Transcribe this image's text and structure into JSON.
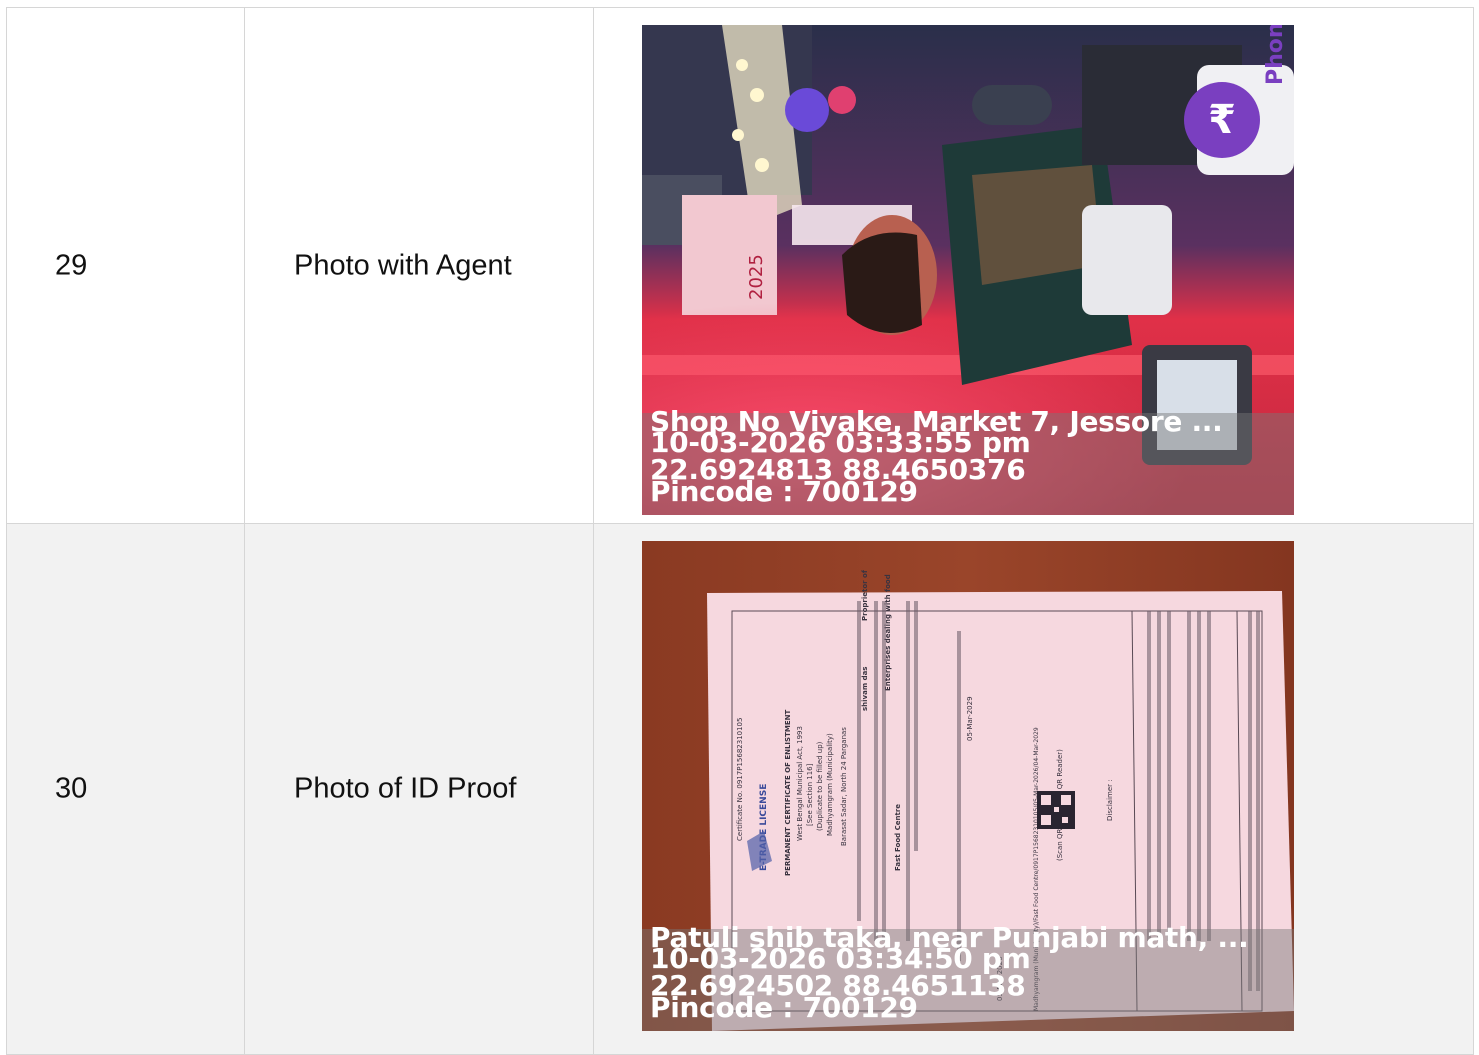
{
  "rows": [
    {
      "number": "29",
      "label": "Photo with Agent",
      "photo_caption": {
        "address": "Shop No Viyake, Market 7, Jessore ...",
        "datetime": "10-03-2026 03:33:55 pm",
        "coordinates": "22.6924813 88.4650376",
        "pincode": "Pincode : 700129"
      },
      "photo_text": {
        "brand": "PhonePe",
        "calendar": "2025"
      }
    },
    {
      "number": "30",
      "label": "Photo of ID Proof",
      "photo_caption": {
        "address": "Patuli shib taka, near Punjabi math, ...",
        "datetime": "10-03-2026 03:34:50 pm",
        "coordinates": "22.6924502 88.4651138",
        "pincode": "Pincode : 700129"
      },
      "document_text": {
        "certificate_no": "Certificate No. 0917P15682310105",
        "logo": "E-TRADE LICENSE",
        "heading": "PERMANENT CERTIFICATE OF ENLISTMENT",
        "act": "West Bengal Municipal Act, 1993",
        "section": "[See Section 116]",
        "duplicate": "(Duplicate to be filled up)",
        "municipality": "Madhyamgram (Municipality)",
        "district": "Barasat Sadar, North 24 Parganas",
        "holder": "shivam das",
        "role": "Proprietor of",
        "business": "Fast Food Centre",
        "nature": "Enterprises dealing with food",
        "validity": "05-Mar-2029",
        "issued": "05-Mar-2026",
        "qr_note": "(Scan QR Code with QR Reader)",
        "disclaimer": "Disclaimer :",
        "ref": "Madhyamgram (Municipality)/Fast Food Centre/0917P15682310105/05-Mar-2026/04-Mar-2029"
      }
    }
  ],
  "colors": {
    "border": "#d6d6d6",
    "row_alt_bg": "#f2f2f2",
    "caption_text": "#ffffff"
  }
}
